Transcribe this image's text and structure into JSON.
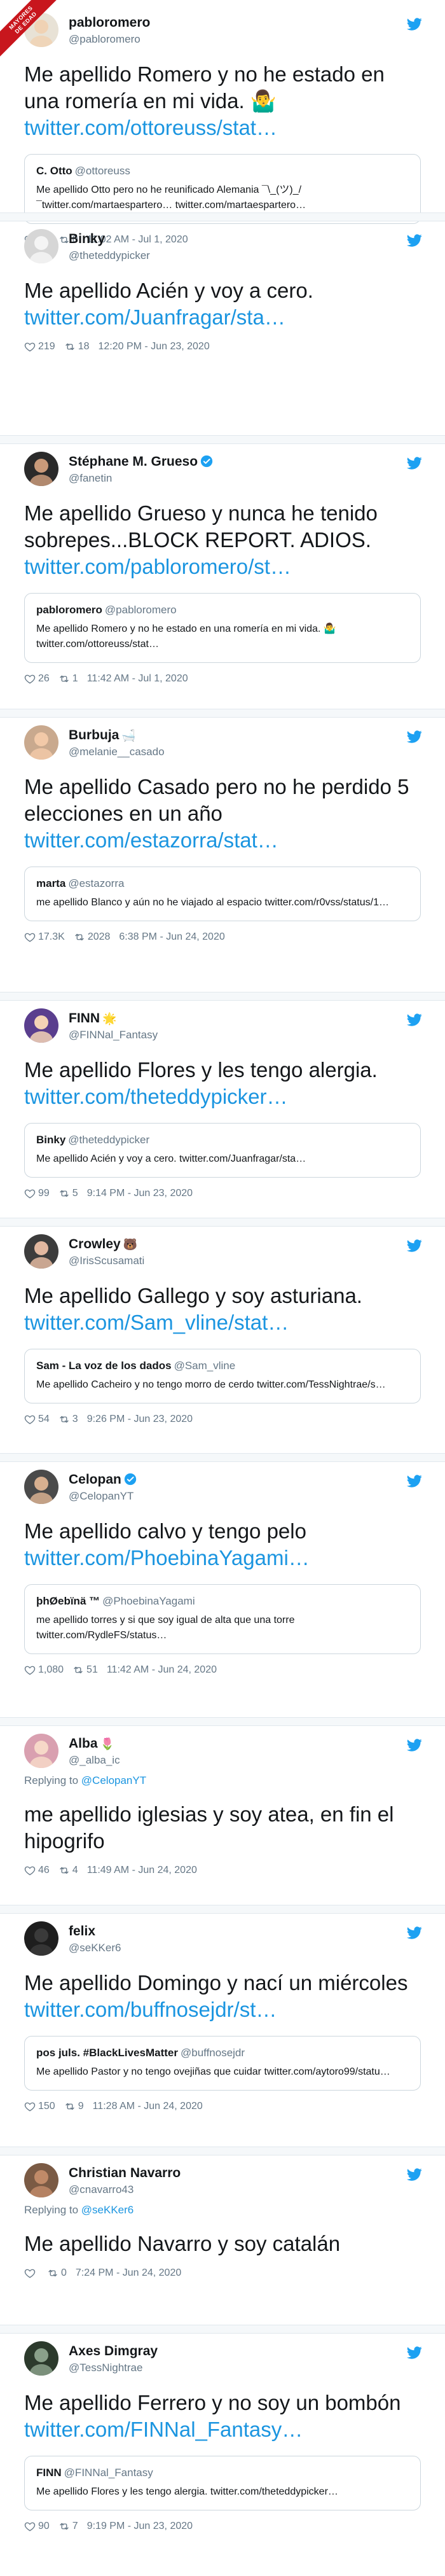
{
  "ribbon": [
    "MAYORES",
    "DE EDAD"
  ],
  "colors": {
    "link": "#1b95e0",
    "muted": "#657786",
    "bird": "#1da1f2",
    "verified": "#1da1f2"
  },
  "tweets": [
    {
      "name": "pabloromero",
      "handle": "@pabloromero",
      "verified": false,
      "emoji": "",
      "reply_to": "",
      "text": "Me apellido Romero y no he estado en una romería en mi vida. 🤷‍♂️",
      "link": "twitter.com/ottoreuss/stat…",
      "quote": {
        "name": "C. Otto",
        "handle": "@ottoreuss",
        "text": "Me apellido Otto pero no he reunificado Alemania ¯\\_(ツ)_/¯twitter.com/martaespartero… twitter.com/martaespartero…"
      },
      "likes": "10",
      "retweets": "0",
      "time": "11:02 AM - Jul 1, 2020"
    },
    {
      "name": "Binky",
      "handle": "@theteddypicker",
      "verified": false,
      "emoji": "",
      "reply_to": "",
      "text": "Me apellido Acién y voy a cero.",
      "link": "twitter.com/Juanfragar/sta…",
      "quote": null,
      "likes": "219",
      "retweets": "18",
      "time": "12:20 PM - Jun 23, 2020"
    },
    {
      "name": "Stéphane M. Grueso",
      "handle": "@fanetin",
      "verified": true,
      "emoji": "",
      "reply_to": "",
      "text": "Me apellido Grueso y nunca he tenido sobrepes...BLOCK REPORT. ADIOS.",
      "link": "twitter.com/pabloromero/st…",
      "quote": {
        "name": "pabloromero",
        "handle": "@pabloromero",
        "text": "Me apellido Romero y no he estado en una romería en mi vida. 🤷‍♂️ twitter.com/ottoreuss/stat…"
      },
      "likes": "26",
      "retweets": "1",
      "time": "11:42 AM - Jul 1, 2020"
    },
    {
      "name": "Burbuja",
      "handle": "@melanie__casado",
      "verified": false,
      "emoji": "🛁",
      "reply_to": "",
      "text": "Me apellido Casado pero no he perdido 5 elecciones en un año",
      "link": "twitter.com/estazorra/stat…",
      "quote": {
        "name": "marta",
        "handle": "@estazorra",
        "text": "me apellido Blanco y aún no he viajado al espacio twitter.com/r0vss/status/1…"
      },
      "likes": "17.3K",
      "retweets": "2028",
      "time": "6:38 PM - Jun 24, 2020"
    },
    {
      "name": "FINN",
      "handle": "@FINNal_Fantasy",
      "verified": false,
      "emoji": "🌟",
      "reply_to": "",
      "text": "Me apellido Flores y les tengo alergia.",
      "link": "twitter.com/theteddypicker…",
      "quote": {
        "name": "Binky",
        "handle": "@theteddypicker",
        "text": "Me apellido Acién y voy a cero. twitter.com/Juanfragar/sta…"
      },
      "likes": "99",
      "retweets": "5",
      "time": "9:14 PM - Jun 23, 2020"
    },
    {
      "name": "Crowley",
      "handle": "@IrisScusamati",
      "verified": false,
      "emoji": "🐻",
      "reply_to": "",
      "text": "Me apellido Gallego y soy asturiana.",
      "link": "twitter.com/Sam_vline/stat…",
      "quote": {
        "name": "Sam - La voz de los dados",
        "handle": "@Sam_vline",
        "text": "Me apellido Cacheiro y no tengo morro de cerdo twitter.com/TessNightrae/s…"
      },
      "likes": "54",
      "retweets": "3",
      "time": "9:26 PM - Jun 23, 2020"
    },
    {
      "name": "Celopan",
      "handle": "@CelopanYT",
      "verified": true,
      "emoji": "",
      "reply_to": "",
      "text": "Me apellido calvo y tengo pelo",
      "link": "twitter.com/PhoebinaYagami…",
      "quote": {
        "name": "þhØebïnä ™",
        "handle": "@PhoebinaYagami",
        "text": "me apellido torres y si que soy igual de alta que una torre twitter.com/RydleFS/status…"
      },
      "likes": "1,080",
      "retweets": "51",
      "time": "11:42 AM - Jun 24, 2020"
    },
    {
      "name": "Alba",
      "handle": "@_alba_ic",
      "verified": false,
      "emoji": "🌷",
      "reply_to": "@CelopanYT",
      "text": "me apellido iglesias y soy atea, en fin el hipogrifo",
      "link": "",
      "quote": null,
      "likes": "46",
      "retweets": "4",
      "time": "11:49 AM - Jun 24, 2020"
    },
    {
      "name": "felix",
      "handle": "@seKKer6",
      "verified": false,
      "emoji": "",
      "reply_to": "",
      "text": "Me apellido Domingo y nací un miércoles",
      "link": "twitter.com/buffnosejdr/st…",
      "quote": {
        "name": "pos juls. #BlackLivesMatter",
        "handle": "@buffnosejdr",
        "text": "Me apellido Pastor y no tengo ovejiñas que cuidar twitter.com/aytoro99/statu…"
      },
      "likes": "150",
      "retweets": "9",
      "time": "11:28 AM - Jun 24, 2020"
    },
    {
      "name": "Christian Navarro",
      "handle": "@cnavarro43",
      "verified": false,
      "emoji": "",
      "reply_to": "@seKKer6",
      "text": "Me apellido Navarro y soy catalán",
      "link": "",
      "quote": null,
      "likes": "",
      "retweets": "0",
      "time": "7:24 PM - Jun 24, 2020"
    },
    {
      "name": "Axes Dimgray",
      "handle": "@TessNightrae",
      "verified": false,
      "emoji": "",
      "reply_to": "",
      "text": "Me apellido Ferrero y no soy un bombón",
      "link": "twitter.com/FINNal_Fantasy…",
      "quote": {
        "name": "FINN",
        "handle": "@FINNal_Fantasy",
        "text": "Me apellido Flores y les tengo alergia. twitter.com/theteddypicker…"
      },
      "likes": "90",
      "retweets": "7",
      "time": "9:19 PM - Jun 23, 2020"
    }
  ],
  "reply_prefix": "Replying to",
  "avatar_icons": [
    "pabloromero-avatar",
    "binky-avatar",
    "grueso-avatar",
    "burbuja-avatar",
    "finn-avatar",
    "crowley-avatar",
    "celopan-avatar",
    "alba-avatar",
    "felix-avatar",
    "navarro-avatar",
    "axes-avatar"
  ]
}
